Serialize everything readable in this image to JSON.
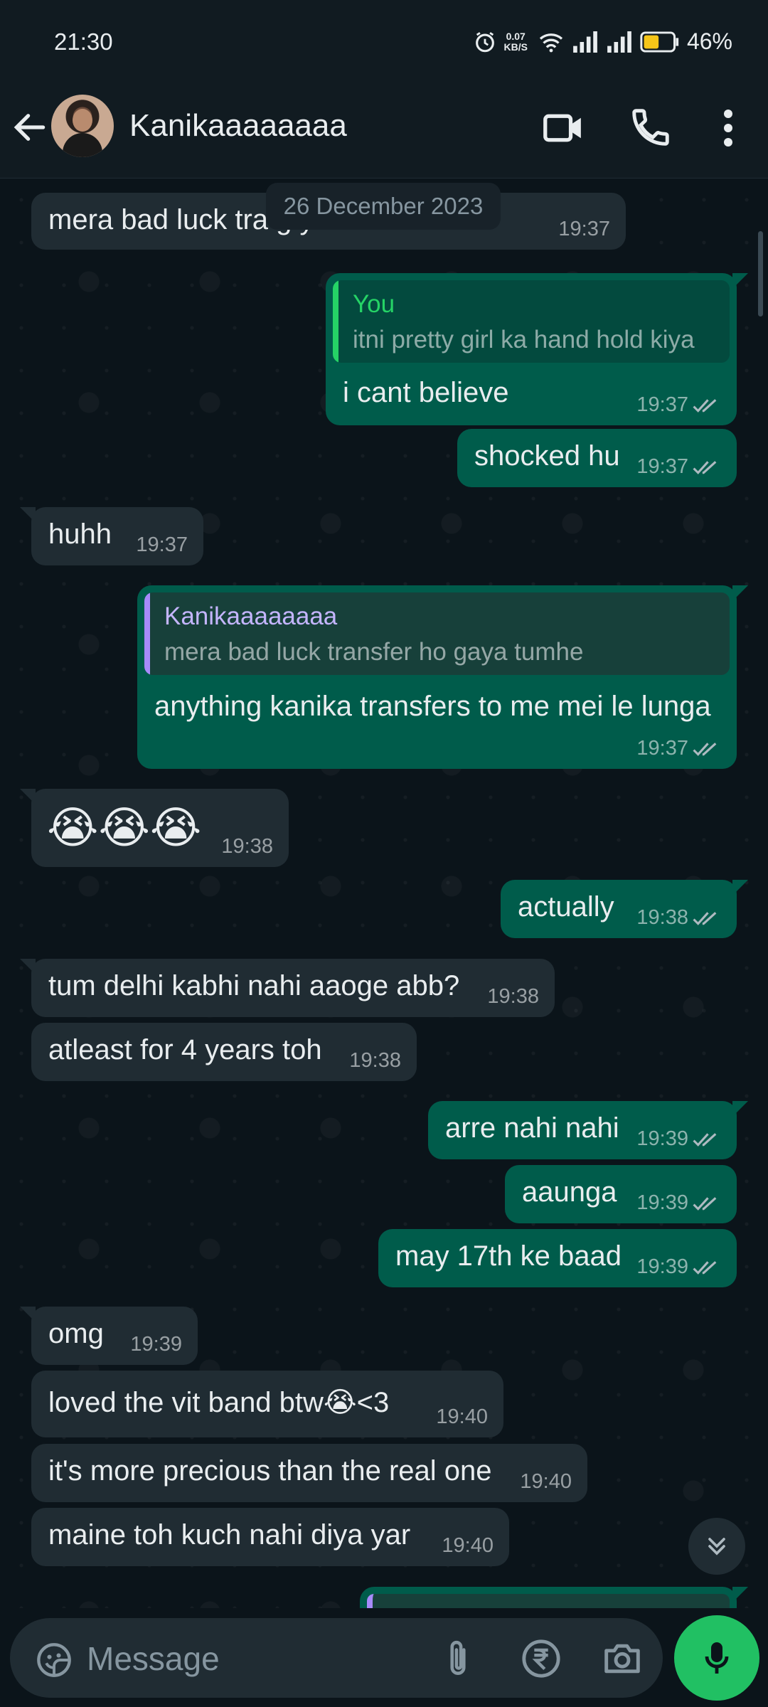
{
  "status_bar": {
    "time": "21:30",
    "net_speed_value": "0.07",
    "net_speed_unit": "KB/S",
    "battery": "46%"
  },
  "header": {
    "contact_name": "Kanikaaaaaaaa"
  },
  "date_chip": "26 December 2023",
  "messages": [
    {
      "dir": "in",
      "text": "mera bad luck tra                g y    the",
      "time": "19:37"
    },
    {
      "dir": "out",
      "quote_name": "You",
      "quote_text": "itni pretty girl ka hand hold kiya",
      "text": "i cant believe",
      "time": "19:37"
    },
    {
      "dir": "out",
      "text": "shocked hu",
      "time": "19:37"
    },
    {
      "dir": "in",
      "text": "huhh",
      "time": "19:37"
    },
    {
      "dir": "out",
      "quote_name": "Kanikaaaaaaaa",
      "quote_text": "mera bad luck transfer ho gaya tumhe",
      "text": "anything kanika transfers to me mei le lunga",
      "time": "19:37"
    },
    {
      "dir": "in",
      "text": "😭😭😭",
      "time": "19:38"
    },
    {
      "dir": "out",
      "text": "actually",
      "time": "19:38"
    },
    {
      "dir": "in",
      "text": "tum delhi kabhi nahi aaoge abb?",
      "time": "19:38"
    },
    {
      "dir": "in",
      "text": "atleast for 4 years toh",
      "time": "19:38"
    },
    {
      "dir": "out",
      "text": "arre nahi nahi",
      "time": "19:39"
    },
    {
      "dir": "out",
      "text": "aaunga",
      "time": "19:39"
    },
    {
      "dir": "out",
      "text": "may 17th ke baad",
      "time": "19:39"
    },
    {
      "dir": "in",
      "text": "omg",
      "time": "19:39"
    },
    {
      "dir": "in",
      "text": "loved the vit band btw😭<3",
      "time": "19:40"
    },
    {
      "dir": "in",
      "text": "it's more precious than the real one",
      "time": "19:40"
    },
    {
      "dir": "in",
      "text": "maine toh kuch nahi diya yar",
      "time": "19:40"
    }
  ],
  "composer": {
    "placeholder": "Message"
  },
  "colors": {
    "incoming": "#202c33",
    "outgoing": "#005c4b",
    "accent_green": "#21c063",
    "quote_you": "#25d366",
    "quote_contact": "#a78bfa"
  }
}
